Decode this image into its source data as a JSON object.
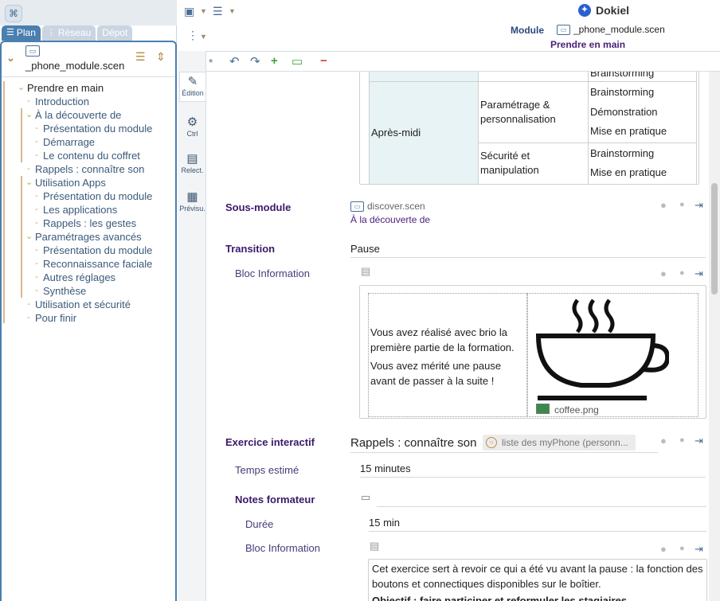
{
  "left": {
    "tabs": [
      {
        "label": "Plan",
        "icon": "plan-icon"
      },
      {
        "label": "Réseau",
        "icon": "network-icon"
      },
      {
        "label": "Dépot",
        "icon": ""
      }
    ],
    "module_file": "_phone_module.scen",
    "tree": [
      {
        "label": "Prendre en main",
        "level": 0,
        "dark": true
      },
      {
        "label": "Introduction",
        "level": 1
      },
      {
        "label": "À la découverte de",
        "level": 1
      },
      {
        "label": "Présentation du module",
        "level": 2
      },
      {
        "label": "Démarrage",
        "level": 2
      },
      {
        "label": "Le contenu du coffret",
        "level": 2
      },
      {
        "label": "Rappels : connaître son",
        "level": 1
      },
      {
        "label": "Utilisation Apps",
        "level": 1
      },
      {
        "label": "Présentation du module",
        "level": 2
      },
      {
        "label": "Les applications",
        "level": 2
      },
      {
        "label": "Rappels : les gestes",
        "level": 2
      },
      {
        "label": "Paramétrages avancés",
        "level": 1
      },
      {
        "label": "Présentation du module",
        "level": 2
      },
      {
        "label": "Reconnaissance faciale",
        "level": 2
      },
      {
        "label": "Autres réglages",
        "level": 2
      },
      {
        "label": "Synthèse",
        "level": 2
      },
      {
        "label": "Utilisation et sécurité",
        "level": 1
      },
      {
        "label": "Pour finir",
        "level": 1
      }
    ]
  },
  "header": {
    "brand": "Dokiel",
    "module_label": "Module",
    "module_file": "_phone_module.scen",
    "module_title": "Prendre en main"
  },
  "sidetabs": [
    {
      "label": "Édition",
      "icon": "pen-icon"
    },
    {
      "label": "Ctrl",
      "icon": "gear-icon"
    },
    {
      "label": "Relect.",
      "icon": "review-icon"
    },
    {
      "label": "Prévisu.",
      "icon": "preview-icon"
    }
  ],
  "schedule": {
    "top_row_right": "Brainstorming",
    "period": "Après-midi",
    "rows": [
      {
        "topic": "Paramétrage & personnalisation",
        "activities": [
          "Brainstorming",
          "Démonstration",
          "Mise en pratique"
        ]
      },
      {
        "topic": "Sécurité et manipulation",
        "activities": [
          "Brainstorming",
          "Mise en pratique"
        ]
      }
    ]
  },
  "sous_module": {
    "label": "Sous-module",
    "file": "discover.scen",
    "title": "À la découverte de"
  },
  "transition": {
    "label": "Transition",
    "value": "Pause",
    "bloc_label": "Bloc Information",
    "text1": "Vous avez réalisé avec brio la première partie de la formation.",
    "text2": "Vous avez mérité une pause avant de passer à la suite !",
    "image_name": "coffee.png"
  },
  "exercice": {
    "label": "Exercice interactif",
    "title": "Rappels : connaître son",
    "chip": "liste des myPhone (personn...",
    "temps_label": "Temps estimé",
    "temps_value": "15 minutes",
    "notes_label": "Notes formateur",
    "duree_label": "Durée",
    "duree_value": "15 min",
    "bloc_label": "Bloc Information",
    "text": "Cet exercice sert à revoir ce qui a été vu avant la pause : la fonction des boutons et connectiques disponibles sur le boîtier.",
    "objectif": "Objectif : faire participer et reformuler les stagiaires"
  }
}
